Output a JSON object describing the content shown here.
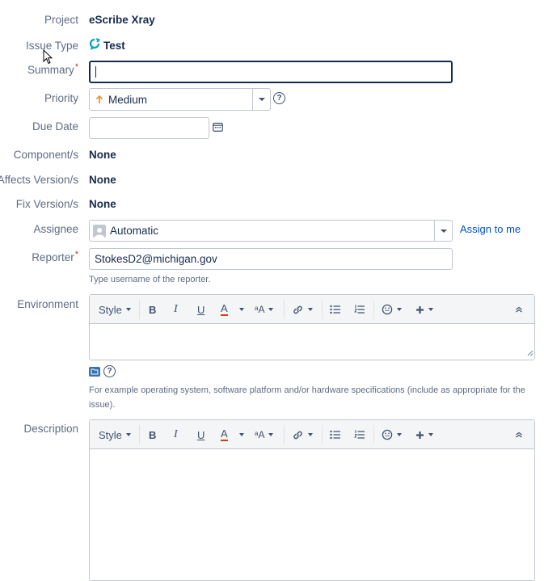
{
  "fields": {
    "project": {
      "label": "Project",
      "value": "eScribe Xray"
    },
    "issue_type": {
      "label": "Issue Type",
      "value": "Test",
      "icon": "xray-test-icon"
    },
    "summary": {
      "label": "Summary",
      "value": "",
      "required_mark": "*"
    },
    "priority": {
      "label": "Priority",
      "value": "Medium",
      "icon": "arrow-up-icon",
      "icon_color": "#f79232"
    },
    "due_date": {
      "label": "Due Date",
      "value": ""
    },
    "components": {
      "label": "Component/s",
      "value": "None"
    },
    "affects_versions": {
      "label": "Affects Version/s",
      "value": "None"
    },
    "fix_versions": {
      "label": "Fix Version/s",
      "value": "None"
    },
    "assignee": {
      "label": "Assignee",
      "value": "Automatic",
      "assign_link": "Assign to me"
    },
    "reporter": {
      "label": "Reporter",
      "value": "StokesD2@michigan.gov",
      "required_mark": "*",
      "hint": "Type username of the reporter."
    },
    "environment": {
      "label": "Environment",
      "hint_line1": "For example operating system, software platform and/or hardware specifications (include as appropriate for the",
      "hint_line2": "issue)."
    },
    "description": {
      "label": "Description"
    }
  },
  "toolbar": {
    "style_label": "Style",
    "bold": "B",
    "italic": "I",
    "underline": "U",
    "text_color": "A",
    "text_size": "ᵃA",
    "accent_color": "#de350b"
  }
}
